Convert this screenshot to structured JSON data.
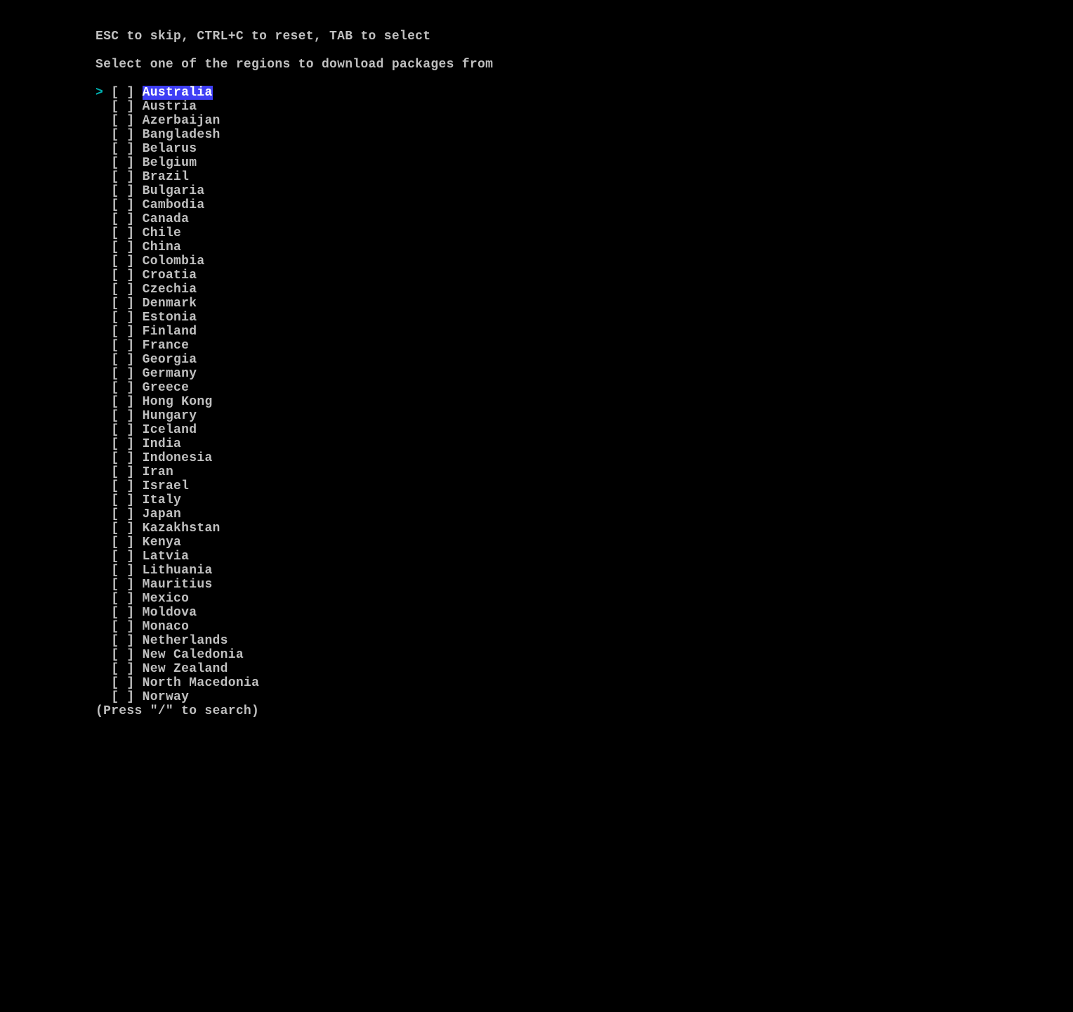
{
  "instructions": "ESC to skip, CTRL+C to reset, TAB to select",
  "prompt": "Select one of the regions to download packages from",
  "cursor": ">",
  "checkbox_prefix": "[ ] ",
  "indent_cursor": " ",
  "indent_nocursor": "  ",
  "regions": [
    {
      "name": "Australia",
      "selected": false,
      "active": true
    },
    {
      "name": "Austria",
      "selected": false,
      "active": false
    },
    {
      "name": "Azerbaijan",
      "selected": false,
      "active": false
    },
    {
      "name": "Bangladesh",
      "selected": false,
      "active": false
    },
    {
      "name": "Belarus",
      "selected": false,
      "active": false
    },
    {
      "name": "Belgium",
      "selected": false,
      "active": false
    },
    {
      "name": "Brazil",
      "selected": false,
      "active": false
    },
    {
      "name": "Bulgaria",
      "selected": false,
      "active": false
    },
    {
      "name": "Cambodia",
      "selected": false,
      "active": false
    },
    {
      "name": "Canada",
      "selected": false,
      "active": false
    },
    {
      "name": "Chile",
      "selected": false,
      "active": false
    },
    {
      "name": "China",
      "selected": false,
      "active": false
    },
    {
      "name": "Colombia",
      "selected": false,
      "active": false
    },
    {
      "name": "Croatia",
      "selected": false,
      "active": false
    },
    {
      "name": "Czechia",
      "selected": false,
      "active": false
    },
    {
      "name": "Denmark",
      "selected": false,
      "active": false
    },
    {
      "name": "Estonia",
      "selected": false,
      "active": false
    },
    {
      "name": "Finland",
      "selected": false,
      "active": false
    },
    {
      "name": "France",
      "selected": false,
      "active": false
    },
    {
      "name": "Georgia",
      "selected": false,
      "active": false
    },
    {
      "name": "Germany",
      "selected": false,
      "active": false
    },
    {
      "name": "Greece",
      "selected": false,
      "active": false
    },
    {
      "name": "Hong Kong",
      "selected": false,
      "active": false
    },
    {
      "name": "Hungary",
      "selected": false,
      "active": false
    },
    {
      "name": "Iceland",
      "selected": false,
      "active": false
    },
    {
      "name": "India",
      "selected": false,
      "active": false
    },
    {
      "name": "Indonesia",
      "selected": false,
      "active": false
    },
    {
      "name": "Iran",
      "selected": false,
      "active": false
    },
    {
      "name": "Israel",
      "selected": false,
      "active": false
    },
    {
      "name": "Italy",
      "selected": false,
      "active": false
    },
    {
      "name": "Japan",
      "selected": false,
      "active": false
    },
    {
      "name": "Kazakhstan",
      "selected": false,
      "active": false
    },
    {
      "name": "Kenya",
      "selected": false,
      "active": false
    },
    {
      "name": "Latvia",
      "selected": false,
      "active": false
    },
    {
      "name": "Lithuania",
      "selected": false,
      "active": false
    },
    {
      "name": "Mauritius",
      "selected": false,
      "active": false
    },
    {
      "name": "Mexico",
      "selected": false,
      "active": false
    },
    {
      "name": "Moldova",
      "selected": false,
      "active": false
    },
    {
      "name": "Monaco",
      "selected": false,
      "active": false
    },
    {
      "name": "Netherlands",
      "selected": false,
      "active": false
    },
    {
      "name": "New Caledonia",
      "selected": false,
      "active": false
    },
    {
      "name": "New Zealand",
      "selected": false,
      "active": false
    },
    {
      "name": "North Macedonia",
      "selected": false,
      "active": false
    },
    {
      "name": "Norway",
      "selected": false,
      "active": false
    }
  ],
  "search_hint": "(Press \"/\" to search)"
}
